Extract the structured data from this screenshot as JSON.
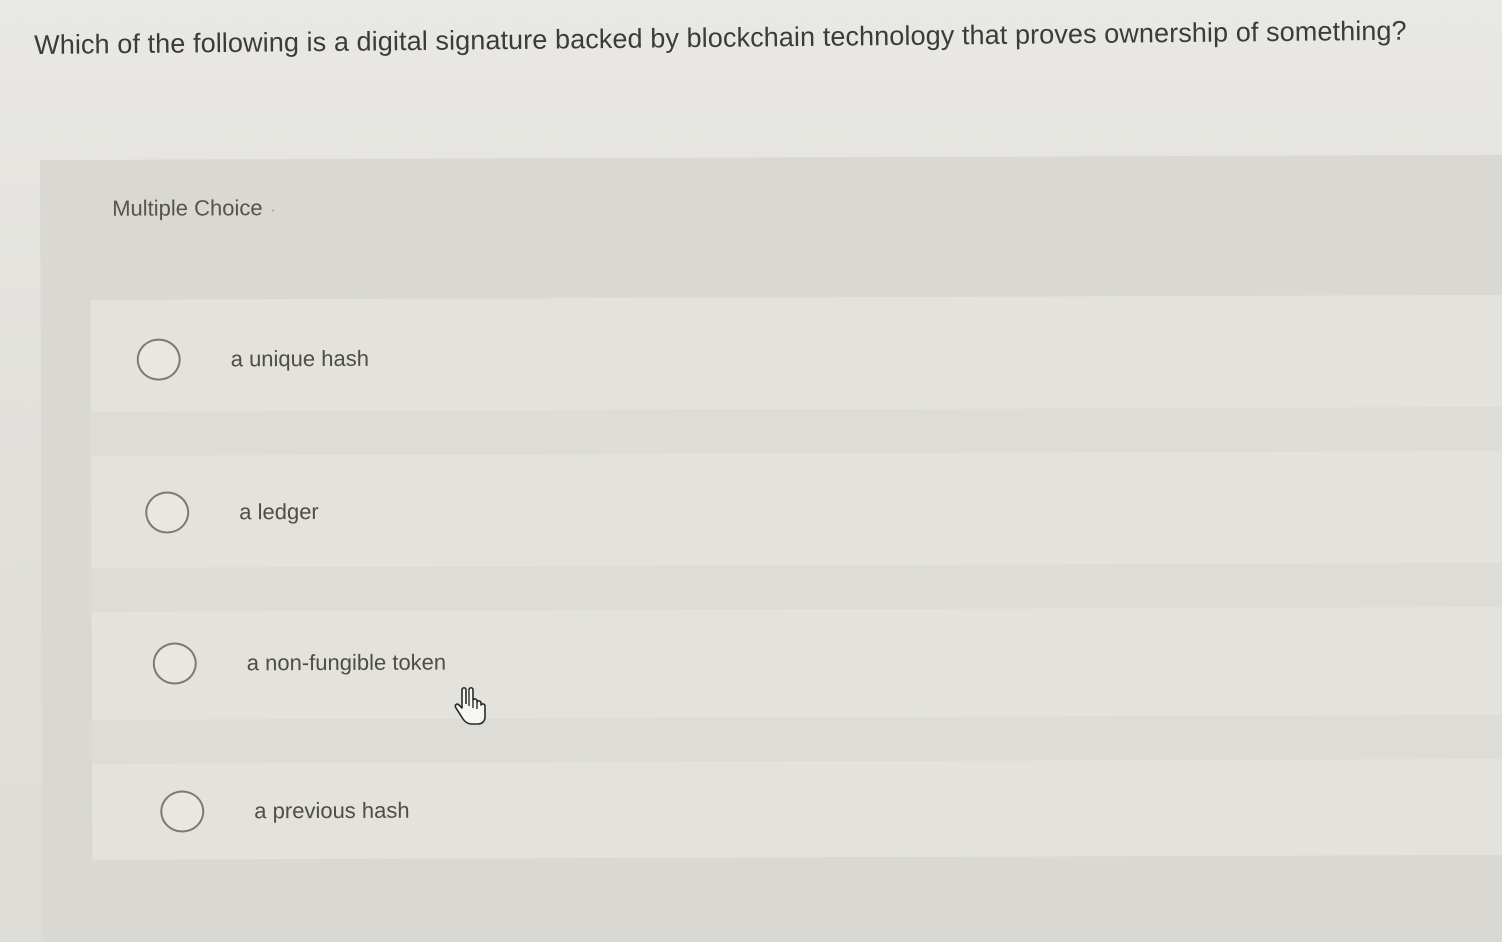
{
  "question": {
    "text": "Which of the following is a digital signature backed by blockchain technology that proves ownership of something?"
  },
  "panel": {
    "label": "Multiple Choice"
  },
  "choices": [
    {
      "label": "a unique hash",
      "selected": false
    },
    {
      "label": "a ledger",
      "selected": false
    },
    {
      "label": "a non-fungible token",
      "selected": false
    },
    {
      "label": "a previous hash",
      "selected": false
    }
  ],
  "cursor": {
    "icon": "hand-pointer-icon"
  }
}
